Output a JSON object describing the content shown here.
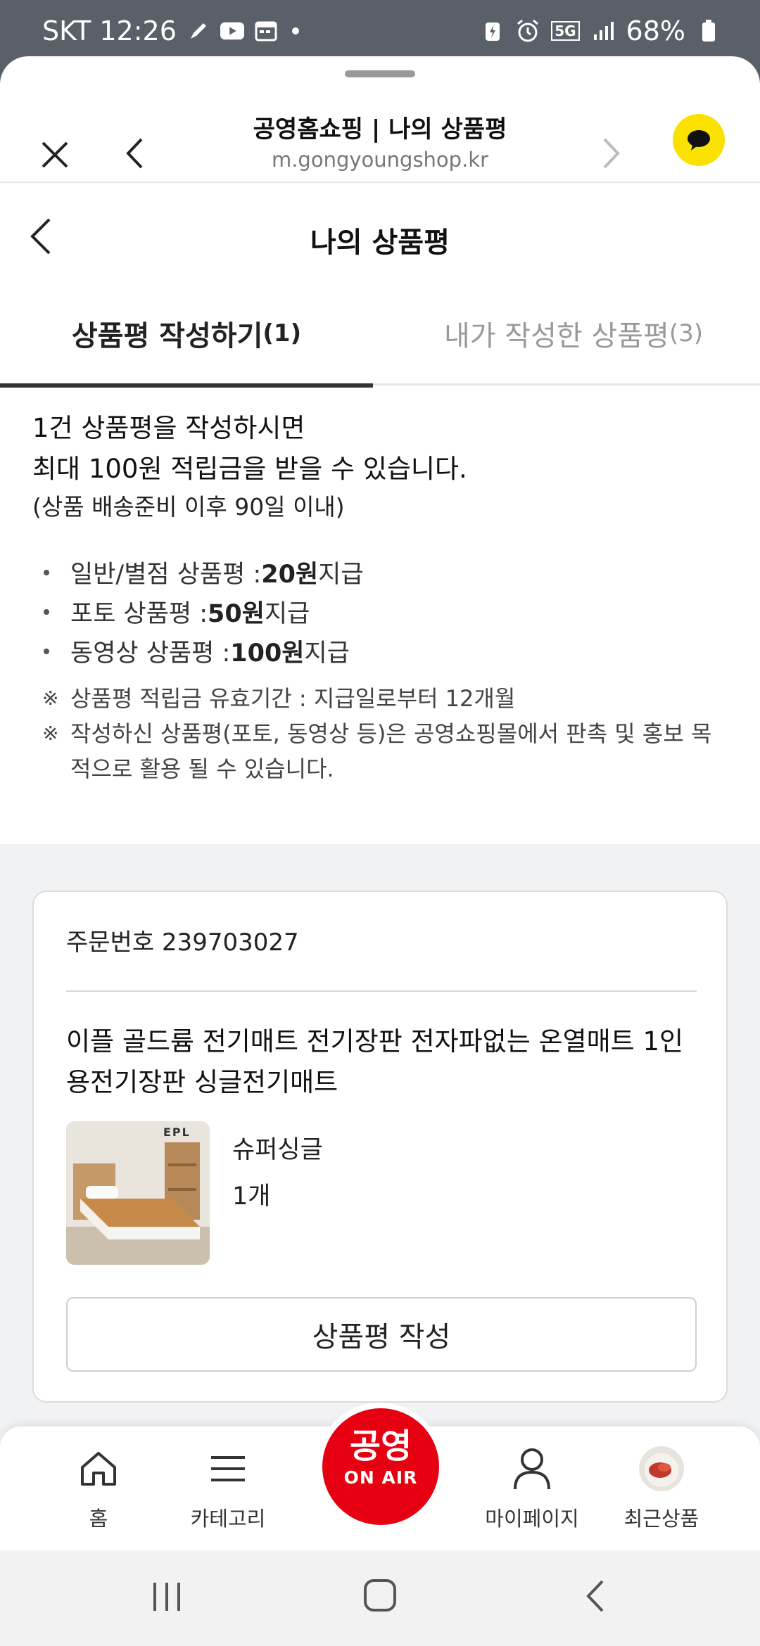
{
  "status_bar": {
    "carrier_time": "SKT 12:26",
    "network": "5G",
    "battery": "68%"
  },
  "browser": {
    "title": "공영홈쇼핑 | 나의 상품평",
    "url": "m.gongyoungshop.kr"
  },
  "page": {
    "title": "나의 상품평"
  },
  "tabs": [
    {
      "label": "상품평 작성하기",
      "count": "(1)"
    },
    {
      "label": "내가 작성한 상품평",
      "count": "(3)"
    }
  ],
  "info": {
    "line1": "1건 상품평을 작성하시면",
    "line2": "최대 100원 적립금을 받을 수 있습니다.",
    "line3": "(상품 배송준비 이후 90일 이내)",
    "bullets": [
      {
        "label": "일반/별점 상품평 : ",
        "amount": "20원",
        "suffix": " 지급"
      },
      {
        "label": "포토 상품평 : ",
        "amount": "50원",
        "suffix": " 지급"
      },
      {
        "label": "동영상 상품평 : ",
        "amount": "100원",
        "suffix": " 지급"
      }
    ],
    "notes": [
      "상품평 적립금 유효기간 : 지급일로부터 12개월",
      "작성하신 상품평(포토, 동영상 등)은 공영쇼핑몰에서 판촉 및 홍보 목적으로 활용 될 수 있습니다."
    ],
    "note_mark": "※"
  },
  "order": {
    "order_label": "주문번호 239703027",
    "product_name": "이플 골드륨 전기매트 전기장판 전자파없는 온열매트 1인용전기장판 싱글전기매트",
    "thumb_brand": "EPL",
    "option": "슈퍼싱글",
    "quantity": "1개",
    "write_button": "상품평 작성"
  },
  "bottom_nav": {
    "home": "홈",
    "category": "카테고리",
    "onair_top": "공영",
    "onair_bottom": "ON AIR",
    "mypage": "마이페이지",
    "recent": "최근상품"
  },
  "colors": {
    "accent": "#e60012",
    "kakao": "#fae100"
  }
}
